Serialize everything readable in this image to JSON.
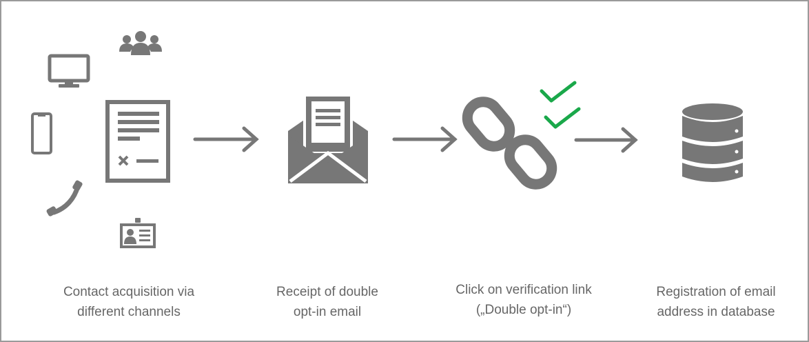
{
  "steps": [
    {
      "line1": "Contact acquisition via",
      "line2": "different channels"
    },
    {
      "line1": "Receipt of double",
      "line2": "opt-in email"
    },
    {
      "line1": "Click on verification link",
      "line2": "(„Double opt-in“)"
    },
    {
      "line1": "Registration of email",
      "line2": "address in database"
    }
  ],
  "icons": {
    "channels": [
      "monitor-icon",
      "people-group-icon",
      "smartphone-icon",
      "phone-handset-icon",
      "id-badge-icon"
    ],
    "form": "form-document-icon",
    "email": "open-envelope-icon",
    "link": "chain-link-icon",
    "checks": "double-check-icon",
    "database": "database-icon"
  },
  "colors": {
    "icon": "#777777",
    "check": "#1aa84a",
    "text": "#666666",
    "border": "#9a9a9a"
  }
}
